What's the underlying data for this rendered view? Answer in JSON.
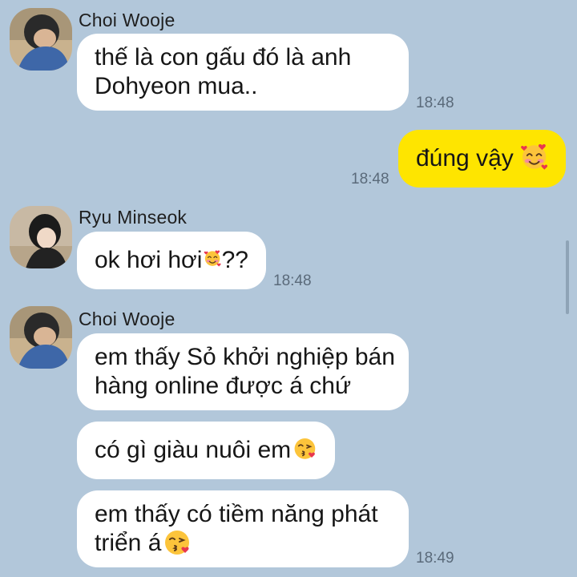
{
  "colors": {
    "background": "#b2c7da",
    "bubble_incoming": "#ffffff",
    "bubble_outgoing": "#fee500",
    "time_text": "#5a6a7a"
  },
  "messages": [
    {
      "sender": "Choi Wooje",
      "lines": [
        "thế là con gấu đó là anh",
        "Dohyeon mua.."
      ],
      "time": "18:48"
    },
    {
      "sender": "me",
      "text": "đúng vậy",
      "emoji": "smiling-face-with-hearts-icon",
      "time": "18:48"
    },
    {
      "sender": "Ryu Minseok",
      "text_before": "ok hơi hơi",
      "emoji": "smiling-face-with-hearts-icon",
      "text_after": "??",
      "time": "18:48"
    },
    {
      "sender": "Choi Wooje",
      "bubbles": [
        {
          "lines": [
            "em thấy Sỏ khởi nghiệp bán",
            "hàng online được á chứ"
          ]
        },
        {
          "text": "có gì giàu nuôi em",
          "emoji": "face-blowing-kiss-icon"
        },
        {
          "lines": [
            "em thấy có tiềm năng phát",
            "triển á"
          ],
          "emoji": "face-blowing-kiss-icon"
        }
      ],
      "time": "18:49"
    }
  ]
}
